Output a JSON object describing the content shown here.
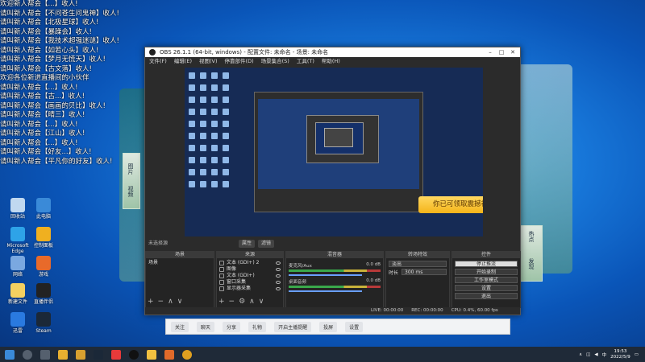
{
  "chat": [
    "欢迎新人帮会【...】收人!",
    "请叫新人帮会【不问苍生问鬼神】收人!",
    "请叫新人帮会【北极星球】收人!",
    "请叫新人帮会【暴躁会】收人!",
    "请叫新人帮会【我技术超强迷谜】收人!",
    "请叫新人帮会【如若心头】收人!",
    "请叫新人帮会【梦月无慌天】收人!",
    "请叫新人帮会【古文落】收人!",
    "欢迎各位新进直播间的小伙伴",
    "请叫新人帮会【...】收人!",
    "请叫新人帮会【古...】收人!",
    "请叫新人帮会【画画的贝比】收人!",
    "请叫新人帮会【晴三】收人!",
    "请叫新人帮会【...】收人!",
    "请叫新人帮会【江山】收人!",
    "请叫新人帮会【...】收人!",
    "请叫新人帮会【好友...】收人!",
    "请叫新人帮会【平凡你的好友】收人!"
  ],
  "desktop_icons": [
    {
      "label": "回收站",
      "color": "#c0d8f0"
    },
    {
      "label": "此电脑",
      "color": "#3a8ad8"
    },
    {
      "label": "Microsoft Edge",
      "color": "#2ea3e8"
    },
    {
      "label": "控制面板",
      "color": "#f0b020"
    },
    {
      "label": "网络",
      "color": "#7aa8e0"
    },
    {
      "label": "游戏",
      "color": "#e86a2a"
    },
    {
      "label": "新建文件",
      "color": "#f4d060"
    },
    {
      "label": "直播伴侣",
      "color": "#222222"
    },
    {
      "label": "迅雷",
      "color": "#2a7ae0"
    },
    {
      "label": "Steam",
      "color": "#1b2838"
    }
  ],
  "obs": {
    "title": "OBS 26.1.1 (64-bit, windows) - 配置文件: 未命名 - 场景: 未命名",
    "menu": [
      "文件(F)",
      "编辑(E)",
      "视图(V)",
      "停靠部件(D)",
      "场景集合(S)",
      "工具(T)",
      "帮助(H)"
    ],
    "popup_text": "你已可领取震撼礼包",
    "preview_toolbar": {
      "label": "未选择源",
      "props": "属性",
      "filters": "滤镜"
    },
    "docks": {
      "scenes": {
        "title": "场景",
        "items": [
          "场景"
        ]
      },
      "sources": {
        "title": "来源",
        "items": [
          "文本 (GDI+) 2",
          "图像",
          "文本 (GDI+)",
          "窗口采集",
          "显示器采集"
        ]
      },
      "mixer": {
        "title": "混音器",
        "rows": [
          {
            "name": "麦克风/Aux",
            "db": "0.0 dB"
          },
          {
            "name": "桌面音频",
            "db": "0.0 dB"
          }
        ]
      },
      "transitions": {
        "title": "转场特效",
        "type": "淡出",
        "duration_label": "时长",
        "duration": "300 ms"
      },
      "controls": {
        "title": "控件",
        "buttons": [
          "停止推流",
          "开始录制",
          "工作室模式",
          "设置",
          "退出"
        ]
      }
    },
    "status": {
      "live": "LIVE: 00:00:00",
      "rec": "REC: 00:00:00",
      "cpu": "CPU: 0.4%, 60.00 fps"
    }
  },
  "lowbar": {
    "items": [
      "关注",
      "聊天",
      "分享",
      "礼物",
      "开启主播提醒",
      "投屏",
      "设置"
    ]
  },
  "side_right": {
    "top": "热点",
    "bottom": "发现"
  },
  "side_left": {
    "top": "图片",
    "bottom": "视频"
  },
  "clock": {
    "time": "19:53",
    "date": "2022/5/9"
  },
  "tray": {
    "lang": "中"
  }
}
